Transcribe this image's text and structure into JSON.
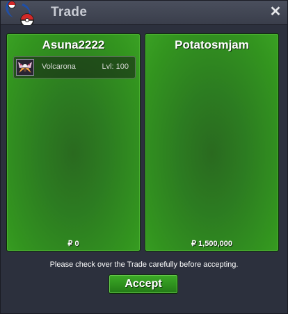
{
  "window": {
    "title": "Trade",
    "close_icon": "close-icon"
  },
  "trade": {
    "left": {
      "name": "Asuna2222",
      "items": [
        {
          "pokemon": "Volcarona",
          "level": "Lvl: 100",
          "icon": "volcarona-icon"
        }
      ],
      "money": "₽ 0"
    },
    "right": {
      "name": "Potatosmjam",
      "items": [],
      "money": "₽ 1,500,000"
    },
    "notice": "Please check over the Trade carefully before accepting.",
    "accept_label": "Accept"
  },
  "colors": {
    "panel_green": "#33951f",
    "window_bg": "#2d313f",
    "accept_green": "#2f921f"
  }
}
